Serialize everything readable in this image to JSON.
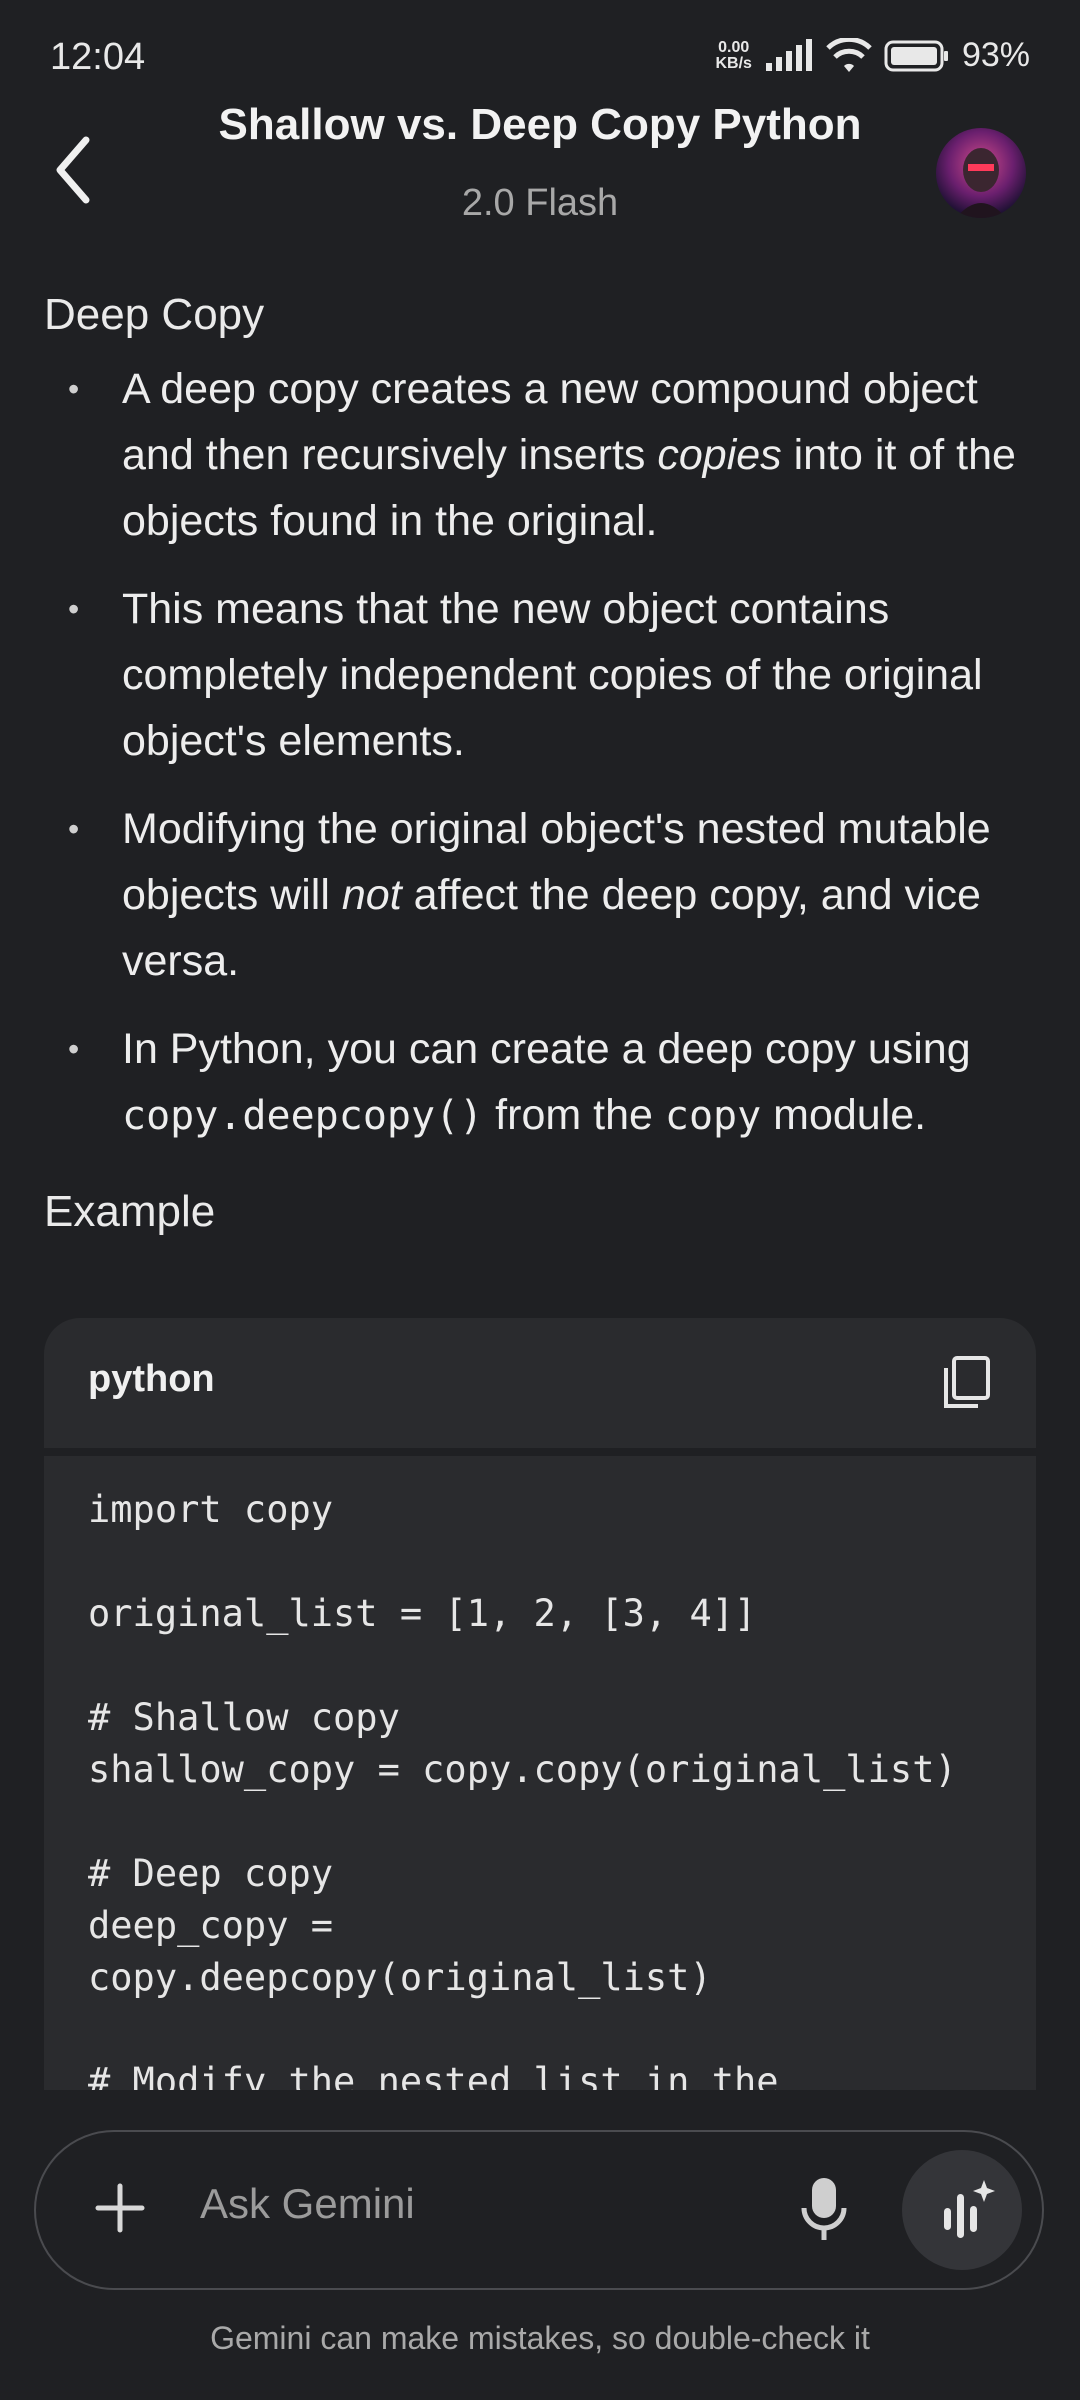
{
  "status": {
    "time": "12:04",
    "speed_value": "0.00",
    "speed_unit": "KB/s",
    "battery": "93%"
  },
  "header": {
    "title": "Shallow vs. Deep Copy Python",
    "model": "2.0 Flash"
  },
  "content": {
    "section_title": "Deep Copy",
    "bullets": {
      "b1_a": "A deep copy creates a new compound object and then recursively inserts ",
      "b1_em": "copies",
      "b1_b": " into it of the objects found in the original.",
      "b2": "This means that the new object contains completely independent copies of the original object's elements.",
      "b3_a": "Modifying the original object's nested mutable objects will ",
      "b3_em": "not",
      "b3_b": " affect the deep copy, and vice versa.",
      "b4_a": "In Python, you can create a deep copy using ",
      "b4_code": "copy.deepcopy()",
      "b4_b": " from the ",
      "b4_code2": "copy",
      "b4_c": " module."
    },
    "example_title": "Example",
    "code": {
      "language": "python",
      "lines": [
        "import copy",
        "",
        "original_list = [1, 2, [3, 4]]",
        "",
        "# Shallow copy",
        "shallow_copy = copy.copy(original_list)",
        "",
        "# Deep copy",
        "deep_copy =",
        "copy.deepcopy(original_list)",
        "",
        "# Modify the nested list in the"
      ]
    }
  },
  "composer": {
    "placeholder": "Ask Gemini"
  },
  "footer": {
    "disclaimer": "Gemini can make mistakes, so double-check it"
  },
  "icons": {
    "back": "back-arrow-icon",
    "copy": "copy-icon",
    "plus": "plus-icon",
    "mic": "microphone-icon",
    "live": "gemini-live-icon"
  }
}
